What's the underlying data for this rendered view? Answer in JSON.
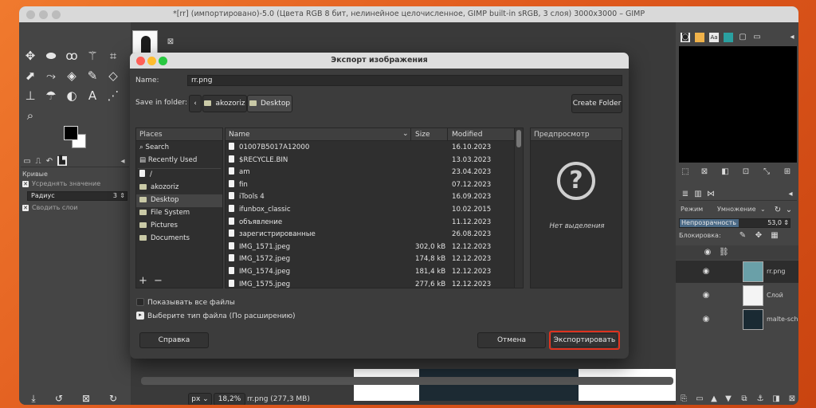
{
  "window": {
    "title": "*[rr] (импортировано)-5.0 (Цвета RGB 8 бит, нелинейное целочисленное, GIMP built-in sRGB, 3 слоя) 3000x3000 – GIMP"
  },
  "tool_options": {
    "title": "Кривые",
    "smooth_label": "Усреднять значение",
    "radius_label": "Радиус",
    "radius_value": "3",
    "merge_label": "Сводить слои"
  },
  "statusbar": {
    "unit": "px",
    "zoom": "18,2%",
    "file_info": "rr.png (277,3 MB)"
  },
  "dialog": {
    "title": "Экспорт изображения",
    "name_label": "Name:",
    "name_value": "rr.png",
    "save_in_label": "Save in folder:",
    "path": [
      "akozoriz",
      "Desktop"
    ],
    "create_folder_label": "Create Folder",
    "places_header": "Places",
    "places": [
      {
        "label": "Search",
        "icon": "search-icon"
      },
      {
        "label": "Recently Used",
        "icon": "recent-icon"
      },
      {
        "label": "/",
        "icon": "drive-icon"
      },
      {
        "label": "akozoriz",
        "icon": "folder-icon"
      },
      {
        "label": "Desktop",
        "icon": "folder-icon"
      },
      {
        "label": "File System",
        "icon": "folder-icon"
      },
      {
        "label": "Pictures",
        "icon": "folder-icon"
      },
      {
        "label": "Documents",
        "icon": "folder-icon"
      }
    ],
    "columns": {
      "name": "Name",
      "size": "Size",
      "modified": "Modified"
    },
    "files": [
      {
        "name": "01007B5017A12000",
        "size": "",
        "modified": "16.10.2023",
        "type": "folder"
      },
      {
        "name": "$RECYCLE.BIN",
        "size": "",
        "modified": "13.03.2023",
        "type": "folder"
      },
      {
        "name": "am",
        "size": "",
        "modified": "23.04.2023",
        "type": "folder"
      },
      {
        "name": "fin",
        "size": "",
        "modified": "07.12.2023",
        "type": "folder"
      },
      {
        "name": "iTools 4",
        "size": "",
        "modified": "16.09.2023",
        "type": "folder"
      },
      {
        "name": "ifunbox_classic",
        "size": "",
        "modified": "10.02.2015",
        "type": "folder"
      },
      {
        "name": "объявление",
        "size": "",
        "modified": "11.12.2023",
        "type": "folder"
      },
      {
        "name": "зарегистрированные",
        "size": "",
        "modified": "26.08.2023",
        "type": "folder"
      },
      {
        "name": "IMG_1571.jpeg",
        "size": "302,0 kB",
        "modified": "12.12.2023",
        "type": "file"
      },
      {
        "name": "IMG_1572.jpeg",
        "size": "174,8 kB",
        "modified": "12.12.2023",
        "type": "file"
      },
      {
        "name": "IMG_1574.jpeg",
        "size": "181,4 kB",
        "modified": "12.12.2023",
        "type": "file"
      },
      {
        "name": "IMG_1575.jpeg",
        "size": "277,6 kB",
        "modified": "12.12.2023",
        "type": "file"
      }
    ],
    "preview_header": "Предпросмотр",
    "preview_empty": "Нет выделения",
    "show_all_label": "Показывать все файлы",
    "file_type_label": "Выберите тип файла (По расширению)",
    "help_label": "Справка",
    "cancel_label": "Отмена",
    "export_label": "Экспортировать",
    "export_highlight_color": "#e0321e"
  },
  "layers_panel": {
    "mode_label": "Режим",
    "mode_value": "Умножение",
    "opacity_label": "Непрозрачность",
    "opacity_value": "53,0",
    "lock_label": "Блокировка:",
    "layers": [
      {
        "name": "rr.png"
      },
      {
        "name": "Слой"
      },
      {
        "name": "malte-schmidt-e"
      }
    ]
  }
}
